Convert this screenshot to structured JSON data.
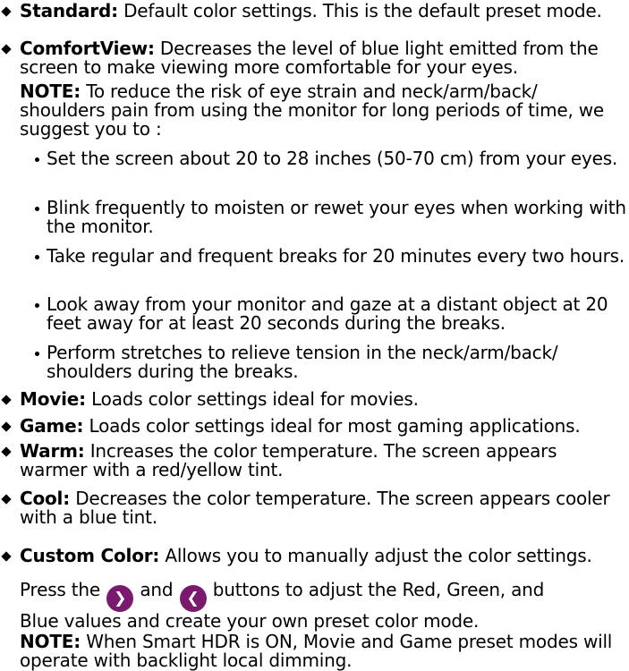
{
  "modes": [
    {
      "label": "Standard:",
      "text": "Default color settings. This is the default preset mode."
    },
    {
      "label": "ComfortView:",
      "text": "Decreases the level of blue light emitted from the screen to make viewing more comfortable for your eyes."
    }
  ],
  "comfort_note": {
    "label": "NOTE:",
    "text": "To reduce the risk of eye strain and neck/arm/back/ shoulders pain from using the monitor for long periods of time, we suggest you to :",
    "tips": [
      "Set the screen about 20 to 28 inches (50-70 cm) from your eyes.",
      "Blink frequently to moisten or rewet your eyes when working with the monitor.",
      "Take regular and frequent breaks for 20 minutes every two hours.",
      "Look away from your monitor and gaze at a distant object at 20 feet away for at least 20 seconds during the breaks.",
      "Perform stretches to relieve tension in the neck/arm/back/ shoulders during the breaks."
    ]
  },
  "modes2": [
    {
      "label": "Movie:",
      "text": "Loads color settings ideal for movies."
    },
    {
      "label": "Game:",
      "text": "Loads color settings ideal for most gaming applications."
    },
    {
      "label": "Warm:",
      "text": "Increases the color temperature. The screen appears warmer with a red/yellow tint."
    },
    {
      "label": "Cool:",
      "text": "Decreases the color temperature. The screen appears cooler with a blue tint."
    },
    {
      "label": "Custom Color:",
      "text": "Allows you to manually adjust the color settings."
    }
  ],
  "custom": {
    "press": "Press the",
    "and": "and",
    "buttons": "buttons to adjust the Red, Green, and",
    "line2": "Blue values and create your own preset color mode."
  },
  "hdr_note": {
    "label": "NOTE:",
    "text": "When Smart HDR is ON, Movie and Game preset modes will operate with backlight local dimming."
  },
  "icons": {
    "right": "chevron-right-icon",
    "left": "chevron-left-icon",
    "color": "#7a1a6e"
  }
}
